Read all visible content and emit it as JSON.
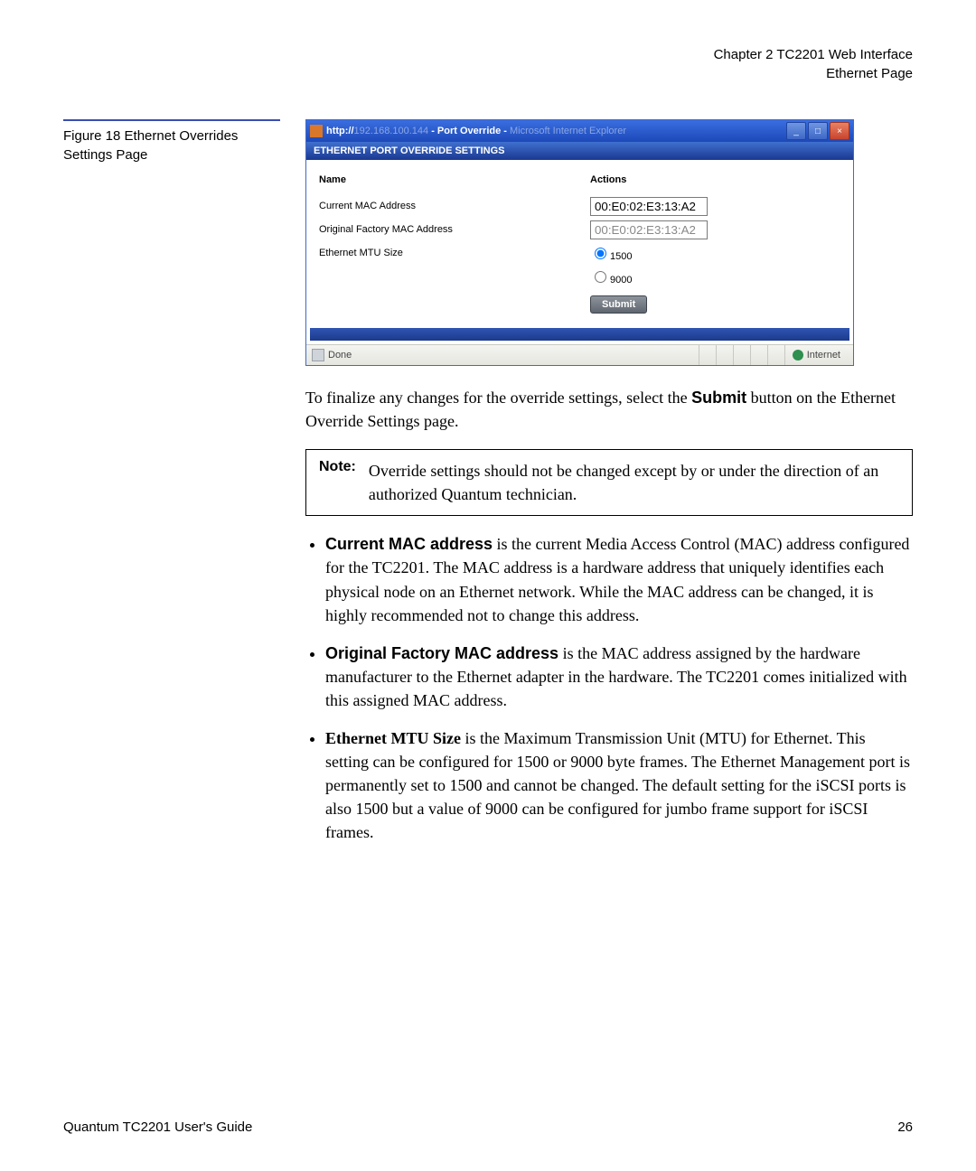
{
  "header": {
    "line1": "Chapter 2  TC2201 Web Interface",
    "line2": "Ethernet Page"
  },
  "figure_caption": "Figure 18  Ethernet Overrides Settings Page",
  "browser": {
    "title_prefix": "http://",
    "title_ip": "192.168.100.144",
    "title_mid": " - Port Override - ",
    "title_suffix": "Microsoft Internet Explorer",
    "headband": "ETHERNET PORT OVERRIDE SETTINGS",
    "col_name": "Name",
    "col_actions": "Actions",
    "row1_label": "Current MAC Address",
    "row1_value": "00:E0:02:E3:13:A2",
    "row2_label": "Original Factory MAC Address",
    "row2_value": "00:E0:02:E3:13:A2",
    "row3_label": "Ethernet MTU Size",
    "mtu_opt1": "1500",
    "mtu_opt2": "9000",
    "submit_label": "Submit",
    "status_done": "Done",
    "status_zone": "Internet"
  },
  "body": {
    "para1_a": "To finalize any changes for the override settings, select the ",
    "para1_b": "Submit",
    "para1_c": " button on the Ethernet Override Settings page.",
    "note_label": "Note:",
    "note_text": "Override settings should not be changed except by or under the direction of an authorized Quantum technician.",
    "b1_bold": "Current MAC address",
    "b1_rest": " is the current Media Access Control (MAC) address configured for the TC2201. The MAC address is a hardware address that uniquely identifies each physical node on an Ethernet network. While the MAC address can be changed, it is highly recommended not to change this address.",
    "b2_bold": "Original Factory MAC address",
    "b2_rest": " is the MAC address assigned by the hardware manufacturer to the Ethernet adapter in the hardware. The TC2201 comes initialized with this assigned MAC address.",
    "b3_bold": "Ethernet MTU Size",
    "b3_rest": " is the Maximum Transmission Unit (MTU) for Ethernet. This setting can be configured for 1500 or 9000 byte frames. The Ethernet Management port is permanently set to 1500 and cannot be changed. The default setting for the iSCSI ports is also 1500 but a value of 9000 can be configured for jumbo frame support for iSCSI frames."
  },
  "footer": {
    "left": "Quantum TC2201 User's Guide",
    "right": "26"
  }
}
